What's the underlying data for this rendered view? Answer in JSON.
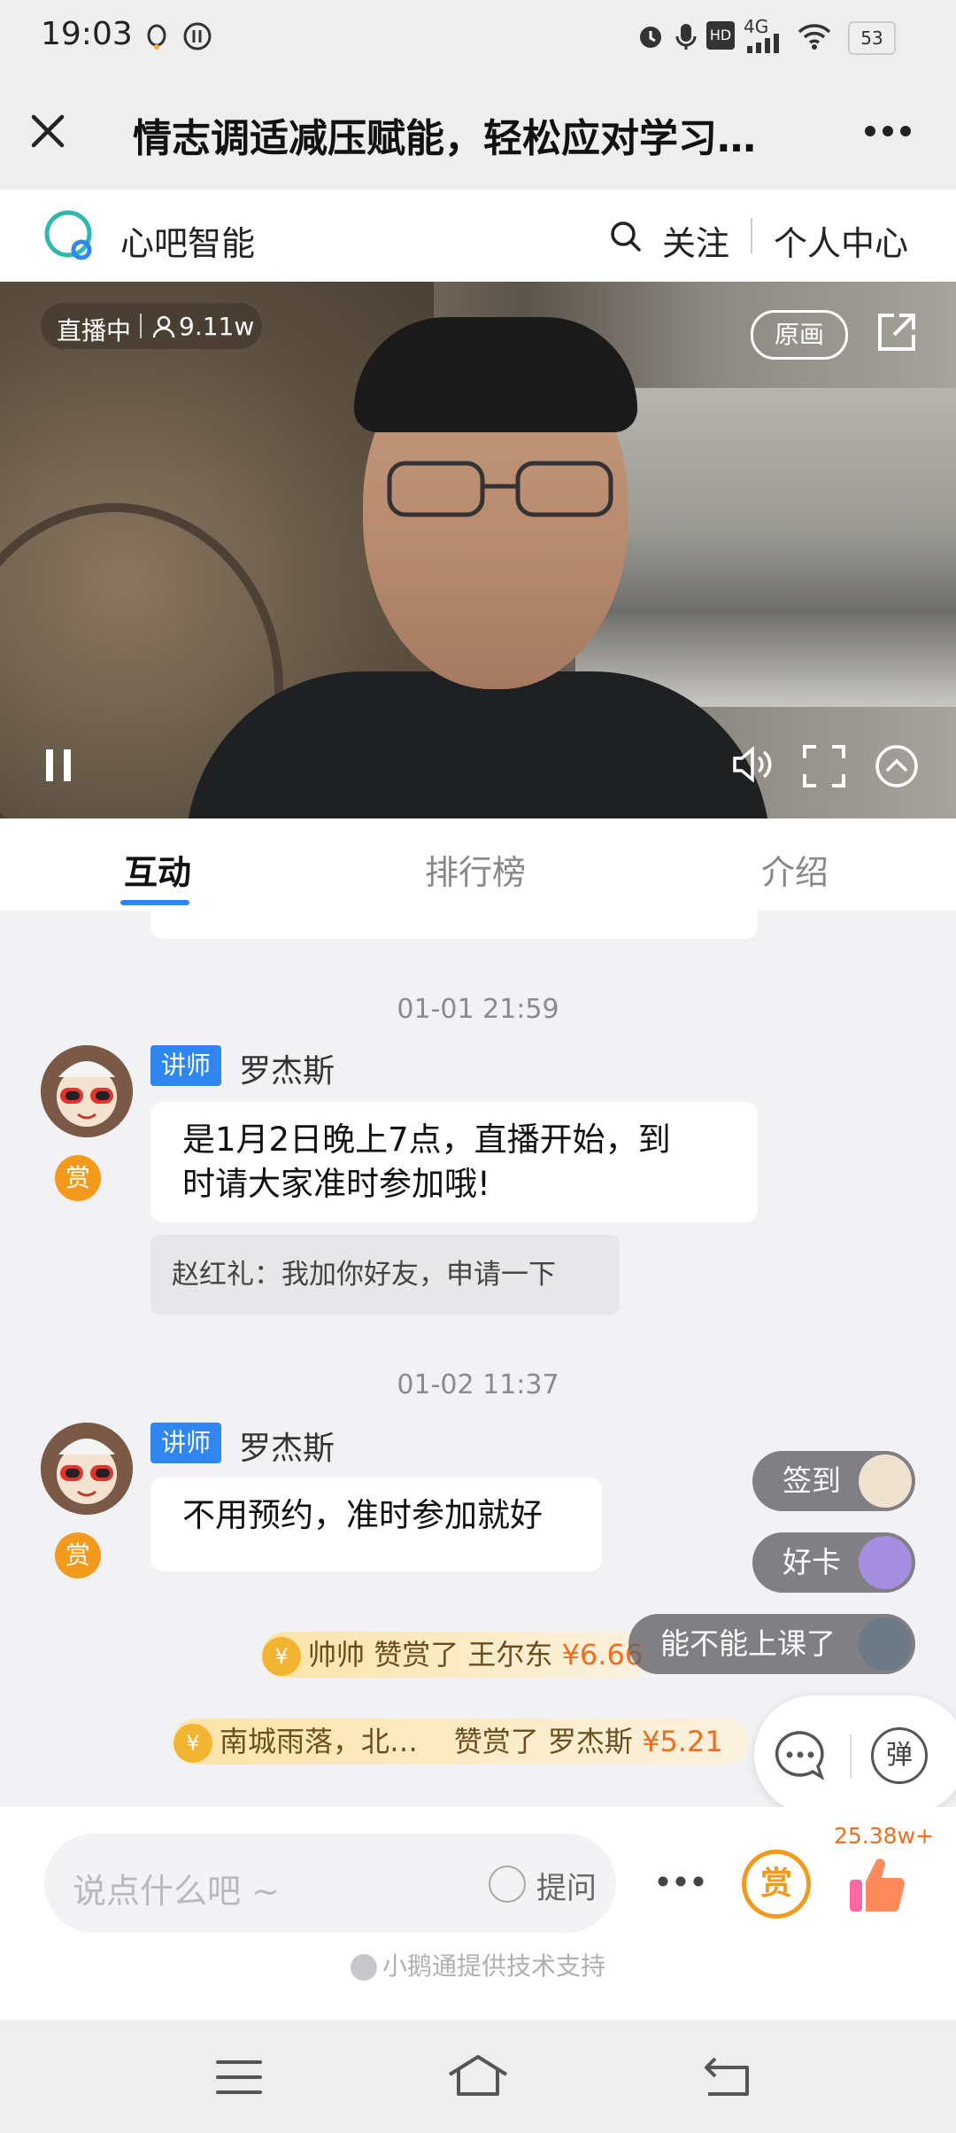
{
  "status_bar": {
    "time": "19:03",
    "battery": "53",
    "network": "4G",
    "hd": "HD"
  },
  "title_bar": {
    "title": "情志调适减压赋能，轻松应对学习…"
  },
  "brand_bar": {
    "brand": "心吧智能",
    "follow": "关注",
    "personal_center": "个人中心"
  },
  "video": {
    "live_label": "直播中",
    "viewers": "9.11w",
    "quality": "原画"
  },
  "tabs": [
    {
      "label": "互动"
    },
    {
      "label": "排行榜"
    },
    {
      "label": "介绍"
    }
  ],
  "chat": {
    "messages": [
      {
        "timestamp": "01-01 21:59",
        "role": "讲师",
        "name": "罗杰斯",
        "text_line1": "是1月2日晚上7点，直播开始，到",
        "text_line2": "时请大家准时参加哦!",
        "reply": "赵红礼：我加你好友，申请一下",
        "tip": "赏"
      },
      {
        "timestamp": "01-02 11:37",
        "role": "讲师",
        "name": "罗杰斯",
        "text_line1": "不用预约，准时参加就好",
        "tip": "赏"
      }
    ],
    "gifts": [
      {
        "sender": "帅帅",
        "verb": "赞赏了",
        "receiver": "王尔东",
        "amount": "¥6.66"
      },
      {
        "sender": "南城雨落，北…",
        "verb": "赞赏了",
        "receiver": "罗杰斯",
        "amount": "¥5.21"
      }
    ]
  },
  "floating_comments": [
    {
      "text": "签到"
    },
    {
      "text": "好卡"
    },
    {
      "text": "能不能上课了"
    }
  ],
  "side_controls": {
    "danmaku_label": "弹"
  },
  "input_bar": {
    "placeholder": "说点什么吧 ~",
    "ask_label": "提问",
    "reward_label": "赏",
    "likes": "25.38w+",
    "support_text": "小鹅通提供技术支持"
  },
  "colors": {
    "accent_blue": "#2f86f0",
    "reward_orange": "#f39a1c",
    "amount_orange": "#f06d1d"
  }
}
